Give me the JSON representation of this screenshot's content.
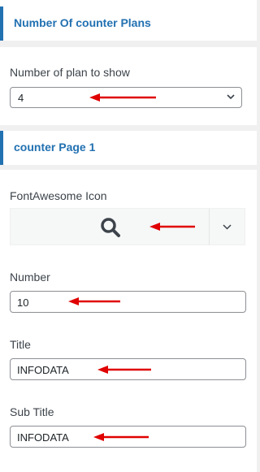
{
  "sections": {
    "plans_header": "Number Of counter Plans",
    "page1_header": "counter Page 1"
  },
  "plan_count": {
    "label": "Number of plan to show",
    "value": "4"
  },
  "icon": {
    "label": "FontAwesome Icon",
    "icon_name": "search-icon"
  },
  "number": {
    "label": "Number",
    "value": "10"
  },
  "title": {
    "label": "Title",
    "value": "INFODATA"
  },
  "subtitle": {
    "label": "Sub Title",
    "value": "INFODATA"
  },
  "colors": {
    "accent": "#2271b1",
    "annotation_arrow": "#e00000"
  }
}
